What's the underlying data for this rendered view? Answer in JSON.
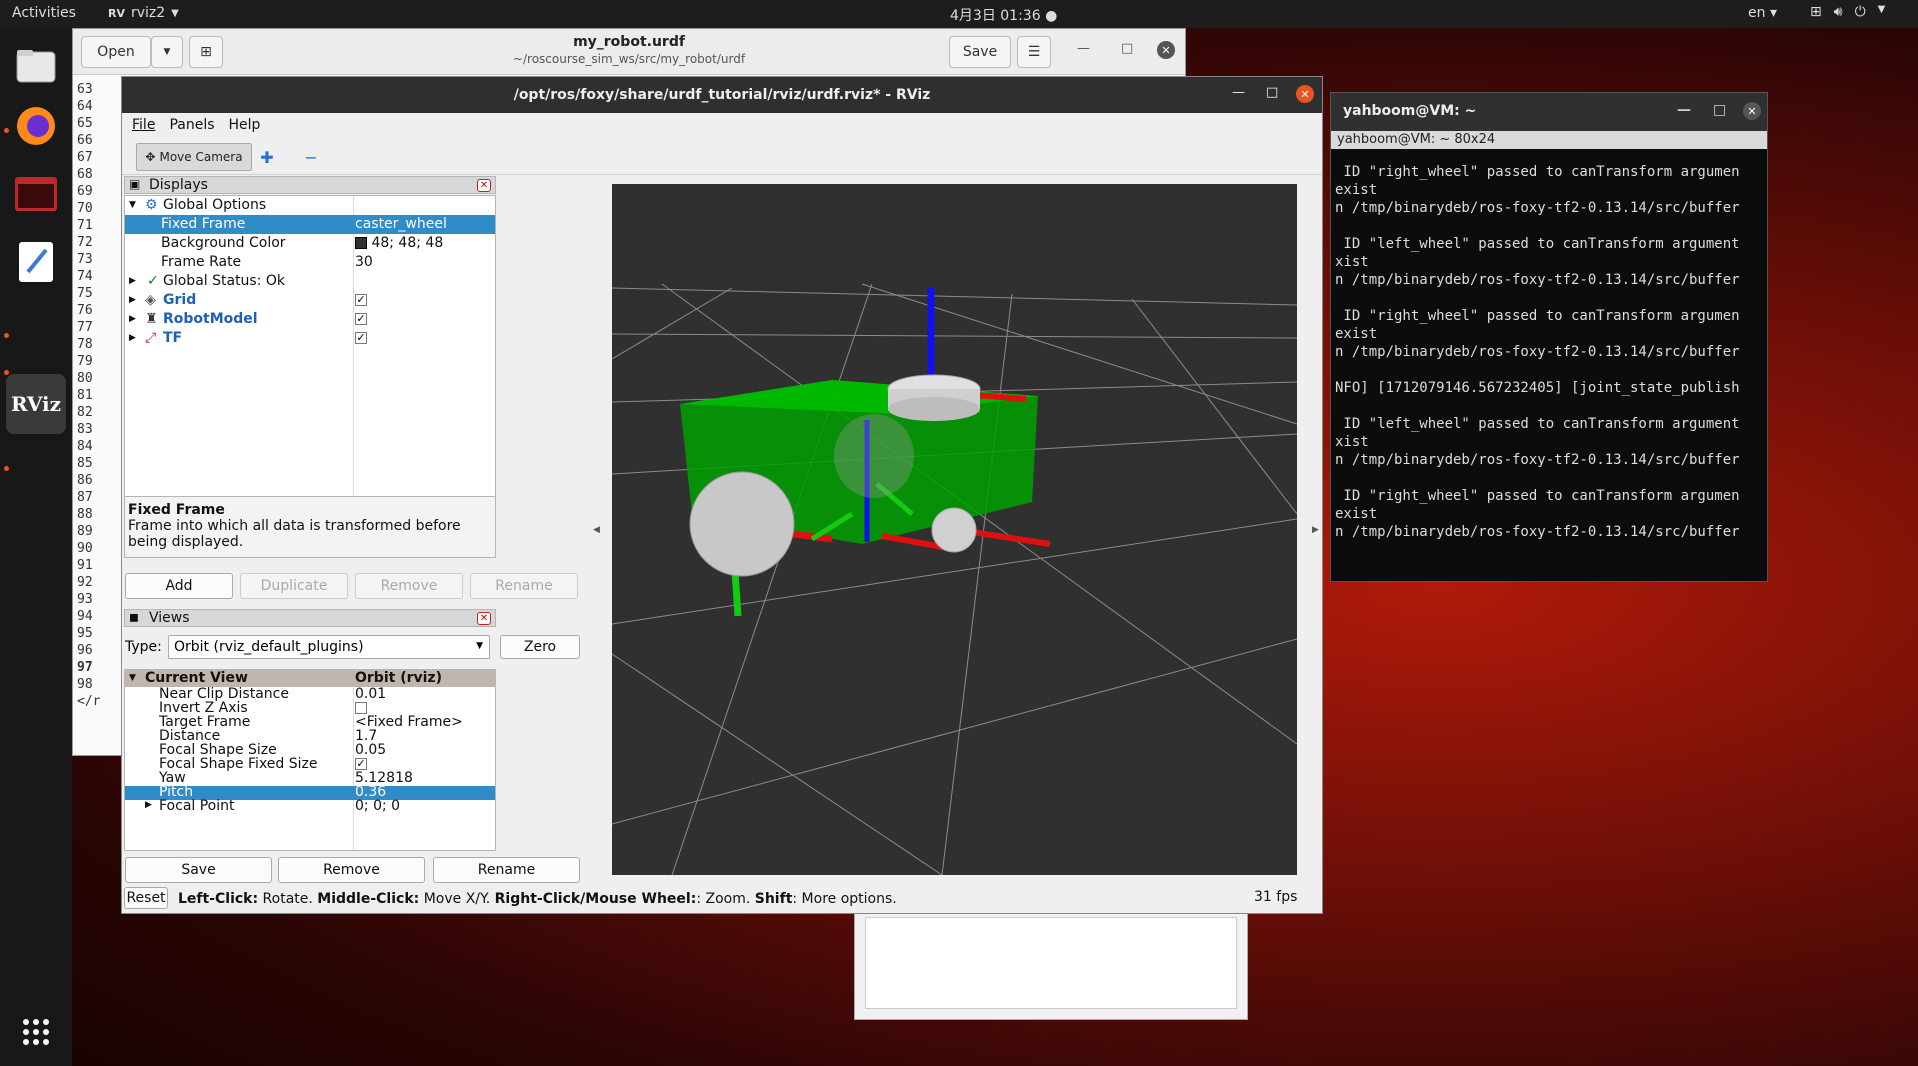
{
  "topbar": {
    "activities": "Activities",
    "app_name": "rviz2",
    "clock": "4月3日 01:36",
    "lang": "en"
  },
  "dock": {
    "items": [
      "files",
      "firefox",
      "terminal",
      "text-editor",
      "rviz"
    ],
    "rviz_label": "RViz"
  },
  "editor": {
    "open_label": "Open",
    "save_label": "Save",
    "title": "my_robot.urdf",
    "subtitle": "~/roscourse_sim_ws/src/my_robot/urdf",
    "line_numbers": [
      "63",
      "64",
      "65",
      "66",
      "67",
      "68",
      "69",
      "70",
      "71",
      "72",
      "73",
      "74",
      "75",
      "76",
      "77",
      "78",
      "79",
      "80",
      "81",
      "82",
      "83",
      "84",
      "85",
      "86",
      "87",
      "88",
      "89",
      "90",
      "91",
      "92",
      "93",
      "94",
      "95",
      "96",
      "97",
      "98 </r"
    ]
  },
  "terminal": {
    "title": "yahboom@VM: ~",
    "tab": "yahboom@VM: ~ 80x24",
    "lines": [
      " ID \"right_wheel\" passed to canTransform argumen",
      "exist",
      "n /tmp/binarydeb/ros-foxy-tf2-0.13.14/src/buffer",
      "",
      " ID \"left_wheel\" passed to canTransform argument",
      "xist",
      "n /tmp/binarydeb/ros-foxy-tf2-0.13.14/src/buffer",
      "",
      " ID \"right_wheel\" passed to canTransform argumen",
      "exist",
      "n /tmp/binarydeb/ros-foxy-tf2-0.13.14/src/buffer",
      "",
      "NFO] [1712079146.567232405] [joint_state_publish",
      "",
      " ID \"left_wheel\" passed to canTransform argument",
      "xist",
      "n /tmp/binarydeb/ros-foxy-tf2-0.13.14/src/buffer",
      "",
      " ID \"right_wheel\" passed to canTransform argumen",
      "exist",
      "n /tmp/binarydeb/ros-foxy-tf2-0.13.14/src/buffer"
    ]
  },
  "rviz": {
    "title": "/opt/ros/foxy/share/urdf_tutorial/rviz/urdf.rviz* - RViz",
    "menu": [
      "File",
      "Panels",
      "Help"
    ],
    "toolbar": {
      "move_camera": "Move Camera"
    },
    "displays": {
      "title": "Displays",
      "global_options": "Global Options",
      "fixed_frame_key": "Fixed Frame",
      "fixed_frame_val": "caster_wheel",
      "bg_color_key": "Background Color",
      "bg_color_val": "48; 48; 48",
      "frame_rate_key": "Frame Rate",
      "frame_rate_val": "30",
      "global_status": "Global Status: Ok",
      "grid": "Grid",
      "robot_model": "RobotModel",
      "tf": "TF"
    },
    "help": {
      "title": "Fixed Frame",
      "text": "Frame into which all data is transformed before being displayed."
    },
    "display_buttons": {
      "add": "Add",
      "duplicate": "Duplicate",
      "remove": "Remove",
      "rename": "Rename"
    },
    "views": {
      "title": "Views",
      "type_label": "Type:",
      "type_value": "Orbit (rviz_default_plugins)",
      "zero": "Zero",
      "current_view": "Current View",
      "current_view_val": "Orbit (rviz)",
      "props": [
        {
          "k": "Near Clip Distance",
          "v": "0.01"
        },
        {
          "k": "Invert Z Axis",
          "v": ""
        },
        {
          "k": "Target Frame",
          "v": "<Fixed Frame>"
        },
        {
          "k": "Distance",
          "v": "1.7"
        },
        {
          "k": "Focal Shape Size",
          "v": "0.05"
        },
        {
          "k": "Focal Shape Fixed Size",
          "v": ""
        },
        {
          "k": "Yaw",
          "v": "5.12818"
        },
        {
          "k": "Pitch",
          "v": "0.36"
        },
        {
          "k": "Focal Point",
          "v": "0; 0; 0"
        }
      ]
    },
    "view_buttons": {
      "save": "Save",
      "remove": "Remove",
      "rename": "Rename"
    },
    "status": {
      "reset": "Reset",
      "left_click_b": "Left-Click:",
      "left_click_t": " Rotate. ",
      "middle_click_b": "Middle-Click:",
      "middle_click_t": " Move X/Y. ",
      "right_click_b": "Right-Click/Mouse Wheel:",
      "right_click_t": ": Zoom. ",
      "shift_b": "Shift",
      "shift_t": ": More options.",
      "fps": "31 fps"
    },
    "colors": {
      "selection": "#308cc6",
      "viewport_bg": "#303030",
      "robot_body": "#00b000"
    }
  }
}
